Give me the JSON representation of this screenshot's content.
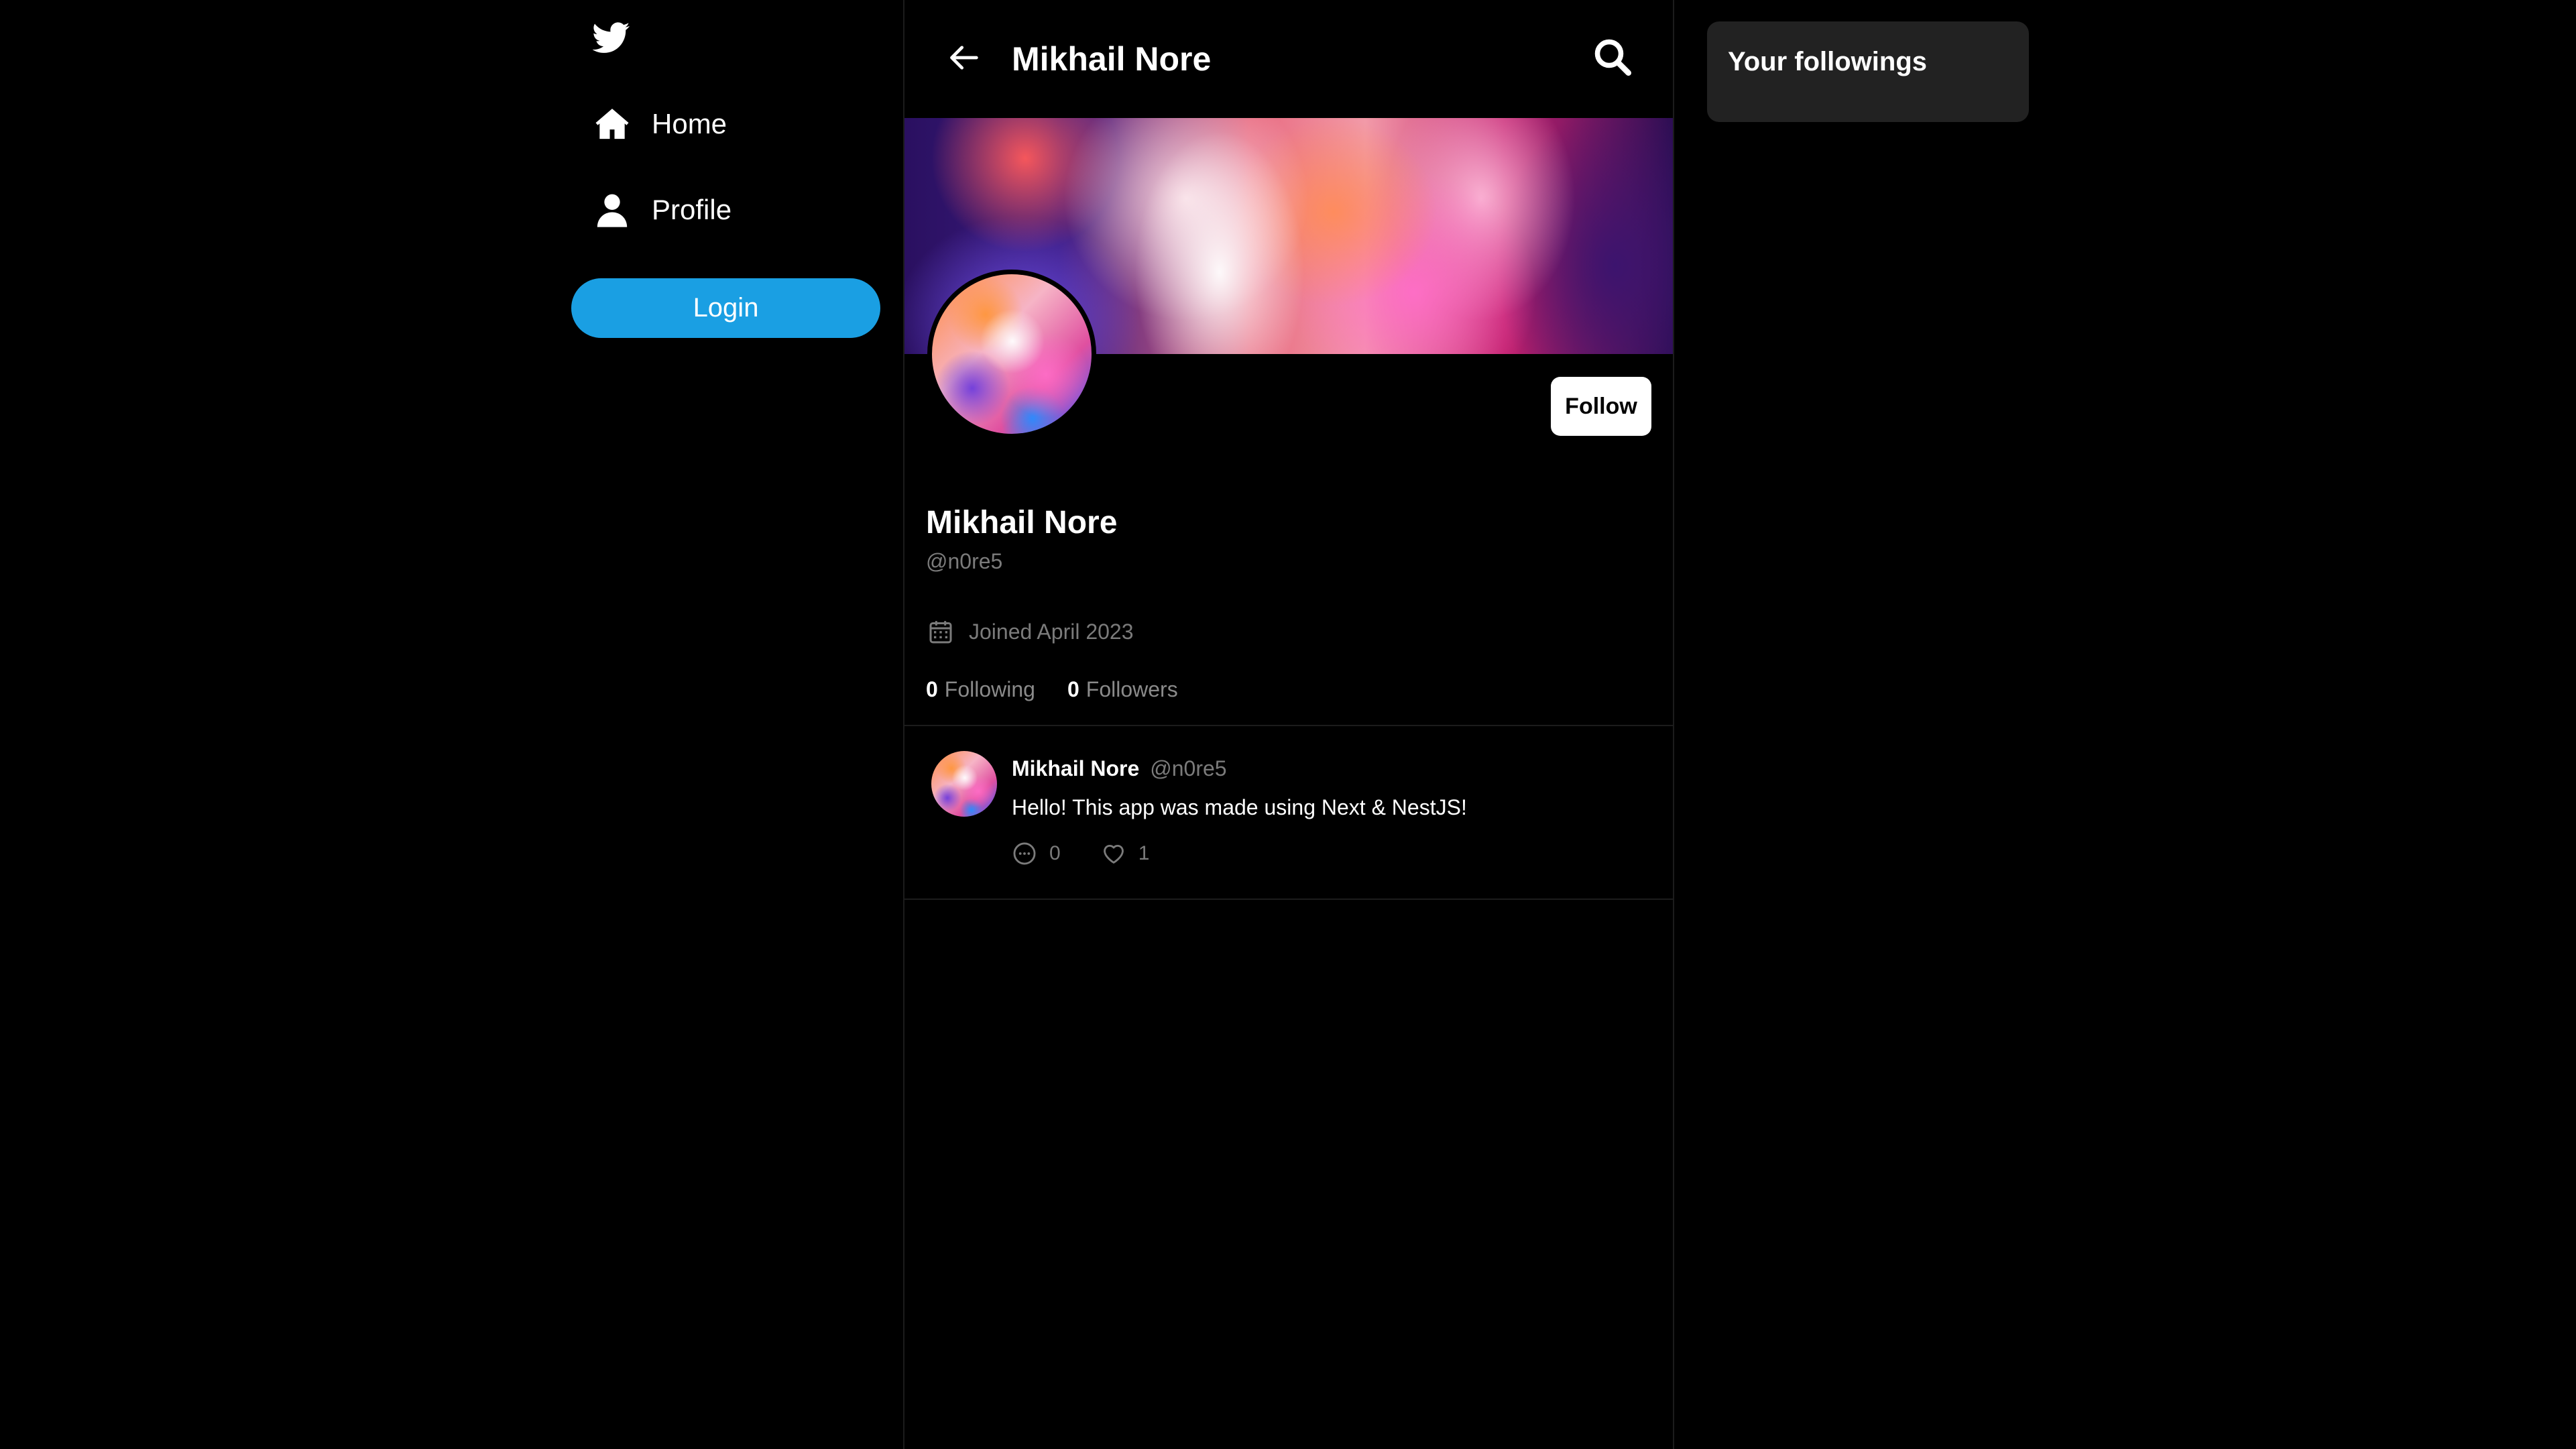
{
  "sidebar": {
    "logo_icon": "twitter-bird-icon",
    "nav": [
      {
        "label": "Home",
        "icon": "home-icon"
      },
      {
        "label": "Profile",
        "icon": "user-icon"
      }
    ],
    "login_label": "Login"
  },
  "header": {
    "title": "Mikhail Nore",
    "back_icon": "arrow-left-icon",
    "search_icon": "search-icon"
  },
  "profile": {
    "name": "Mikhail Nore",
    "handle": "@n0re5",
    "joined": "Joined April 2023",
    "follow_label": "Follow",
    "following_count": "0",
    "following_label": "Following",
    "followers_count": "0",
    "followers_label": "Followers"
  },
  "tweets": [
    {
      "author": "Mikhail Nore",
      "handle": "@n0re5",
      "text": "Hello! This app was made using Next & NestJS!",
      "comments": "0",
      "likes": "1"
    }
  ],
  "right_panel": {
    "title": "Your followings"
  },
  "colors": {
    "background": "#000000",
    "accent": "#1a9fe3",
    "panel": "#222222",
    "muted_text": "#7b7b7b",
    "divider": "#1c1c1c"
  }
}
